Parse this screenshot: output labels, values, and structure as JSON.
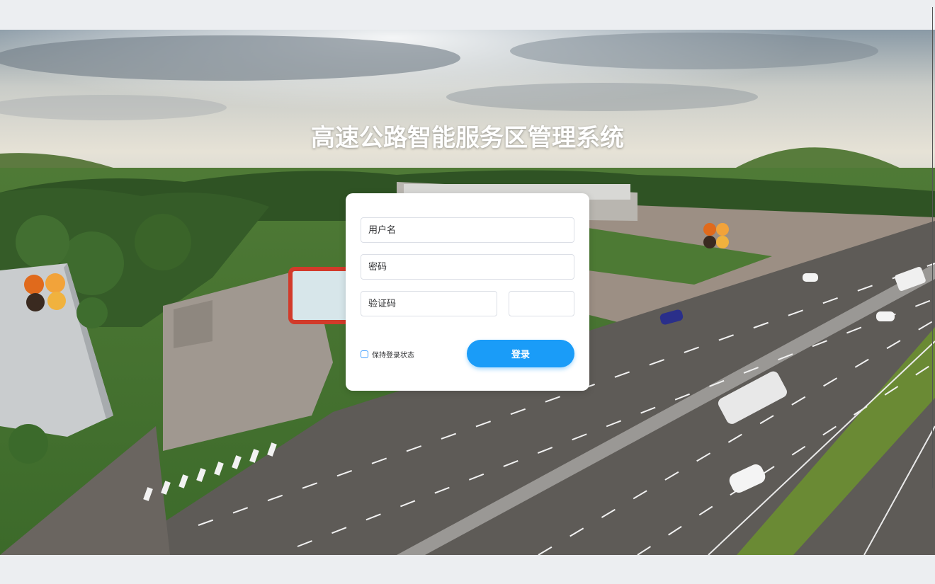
{
  "app": {
    "title": "高速公路智能服务区管理系统"
  },
  "login": {
    "username_placeholder": "用户名",
    "password_placeholder": "密码",
    "captcha_placeholder": "验证码",
    "remember_label": "保持登录状态",
    "submit_label": "登录"
  },
  "theme": {
    "accent": "#1a9cf8",
    "page_background": "#eceef1",
    "card_background": "#ffffff"
  }
}
